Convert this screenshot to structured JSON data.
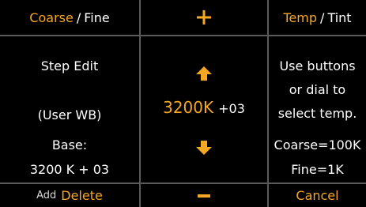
{
  "top_bar": {
    "coarse_label": "Coarse",
    "slash": "/",
    "fine_label": "Fine",
    "plus_symbol": "+",
    "temp_label": "Temp",
    "tint_label": "Tint"
  },
  "left_panel": {
    "mode_title": "Step Edit",
    "mode_subtitle": "(User WB)",
    "base_label": "Base:",
    "base_value": "3200 K + 03"
  },
  "center_panel": {
    "temperature_value": "3200K",
    "tint_offset": "+03"
  },
  "right_panel": {
    "help_line1": "Use buttons",
    "help_line2": "or dial to",
    "help_line3": "select temp.",
    "coarse_step": "Coarse=100K",
    "fine_step": "Fine=1K"
  },
  "bottom_bar": {
    "add_label": "Add",
    "delete_label": "Delete",
    "minus_symbol": "–",
    "cancel_label": "Cancel"
  },
  "colors": {
    "accent": "#f5a623",
    "text": "#ffffff",
    "background": "#000000",
    "divider": "#5a5a5a"
  }
}
